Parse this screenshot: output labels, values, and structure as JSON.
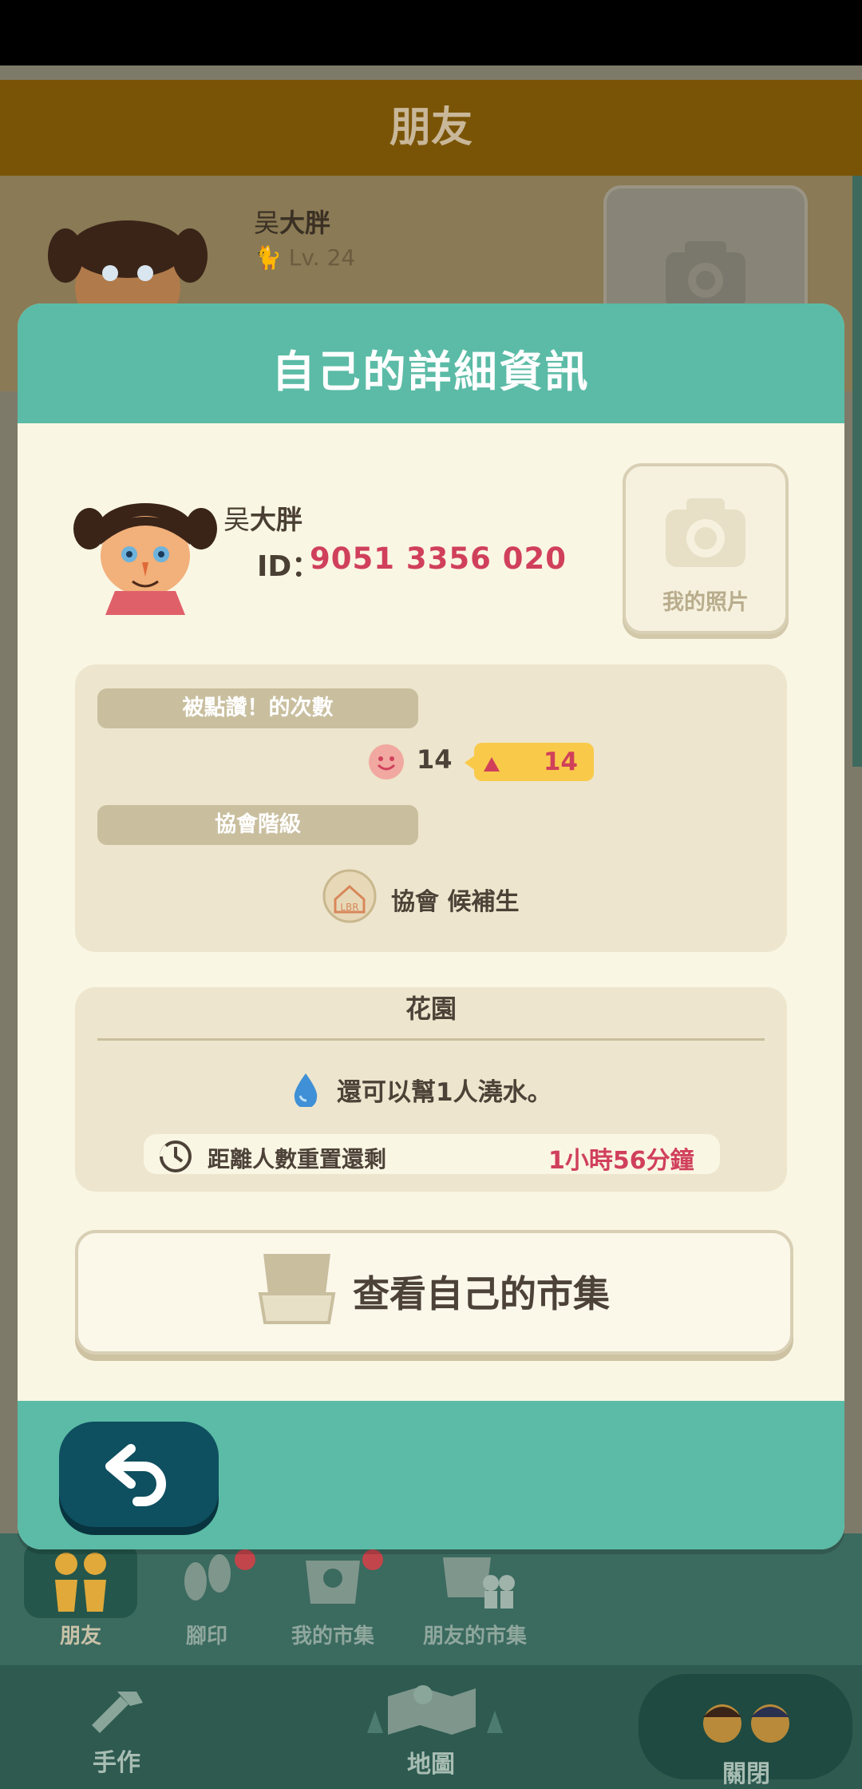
{
  "background": {
    "header_title": "朋友",
    "friend": {
      "surname": "吴",
      "given_name": "大胖",
      "level": "Lv. 24"
    },
    "tabs": [
      {
        "label": "朋友",
        "icon": "friends-icon",
        "active": true
      },
      {
        "label": "腳印",
        "icon": "footprints-icon",
        "badge": true
      },
      {
        "label": "我的市集",
        "icon": "my-market-icon",
        "badge": true
      },
      {
        "label": "朋友的市集",
        "icon": "friends-market-icon"
      }
    ],
    "bottom_bar": {
      "craft_label": "手作",
      "map_label": "地圖",
      "close_label": "關閉"
    }
  },
  "modal": {
    "title": "自己的詳細資訊",
    "profile": {
      "surname": "吴",
      "given_name": "大胖",
      "id_label": "ID：",
      "id_value": "9051 3356 020"
    },
    "photo_button": {
      "label": "我的照片",
      "icon": "camera-icon"
    },
    "likes": {
      "section_label": "被點讚！的次數",
      "count": "14",
      "increase": "14"
    },
    "association": {
      "section_label": "協會階級",
      "rank": "協會 候補生"
    },
    "garden": {
      "title": "花園",
      "water_text": "還可以幫1人澆水。",
      "timer_label": "距離人數重置還剩",
      "timer_value": "1小時56分鐘"
    },
    "market_button": {
      "label": "查看自己的市集"
    },
    "back_button": {
      "icon": "back-arrow-icon"
    }
  },
  "colors": {
    "teal": "#5bbba6",
    "cream": "#faf6e4",
    "panel": "#ede5cd",
    "accent_red": "#d0405a",
    "badge_yellow": "#f9c94a",
    "back_button": "#0e4f60"
  }
}
